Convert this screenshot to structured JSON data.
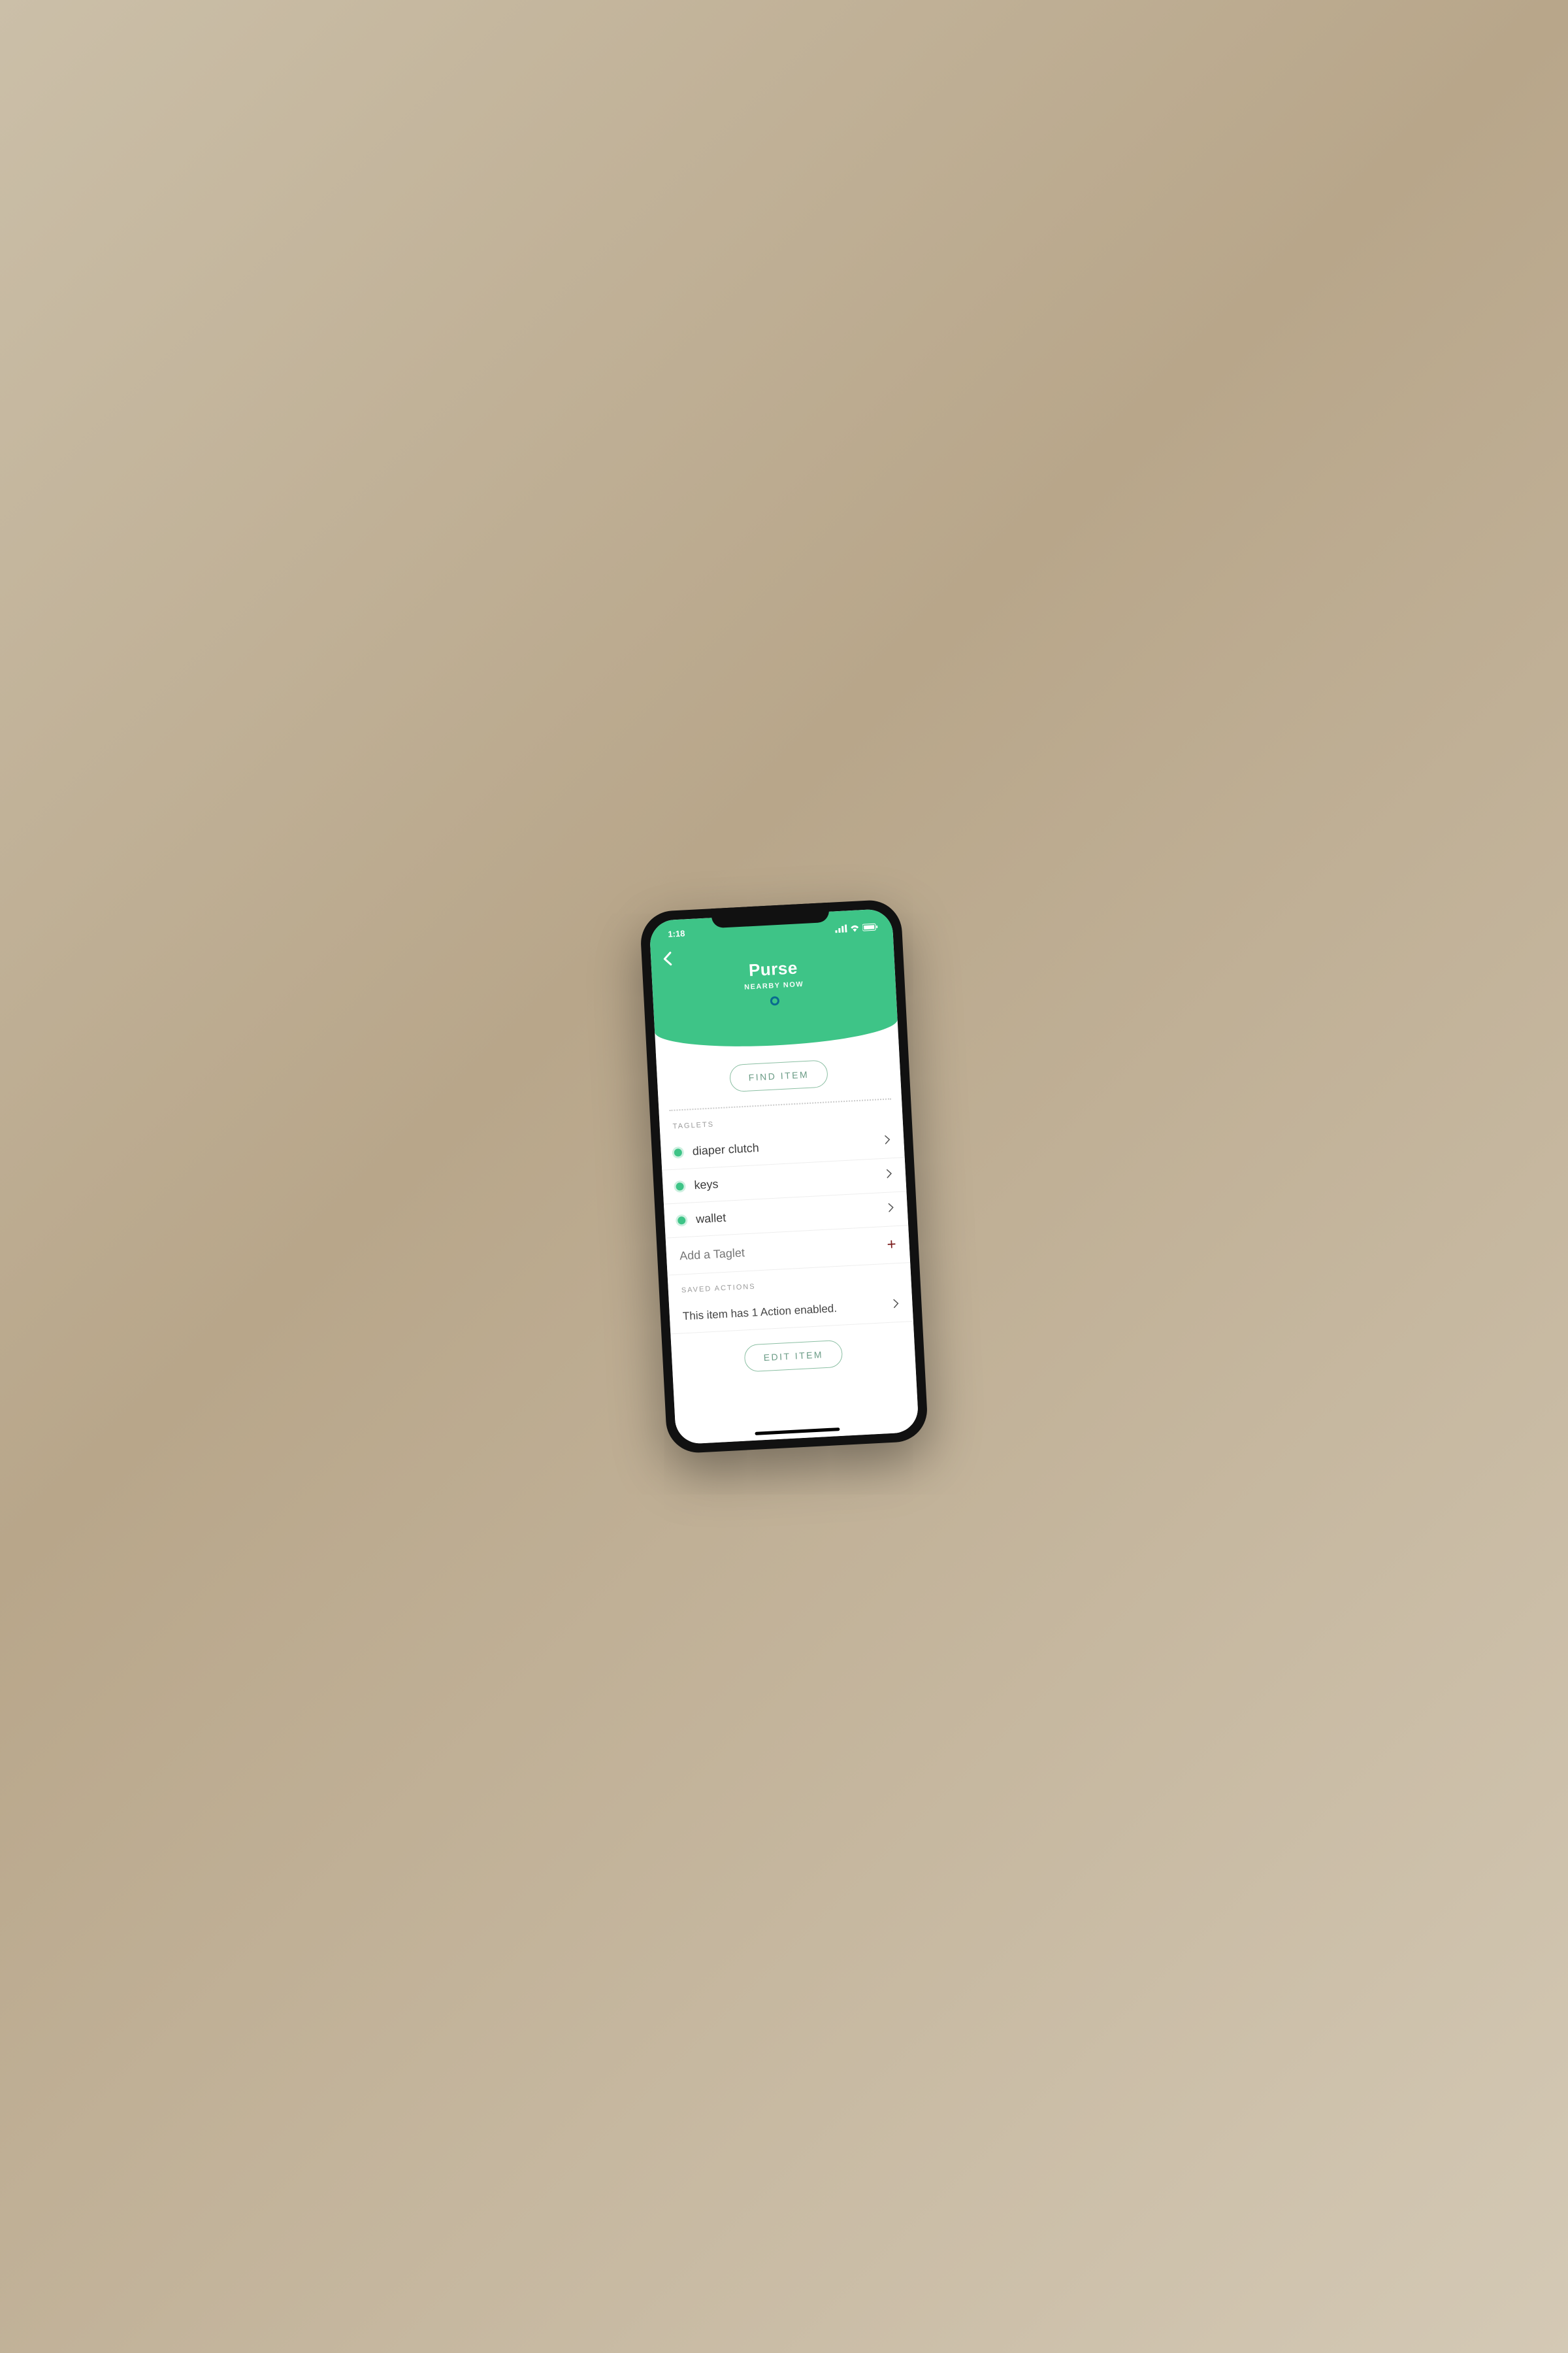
{
  "status_bar": {
    "time": "1:18",
    "signal": "●●●●",
    "wifi": "wifi",
    "battery": "battery"
  },
  "header": {
    "title": "Purse",
    "subtitle": "NEARBY NOW"
  },
  "buttons": {
    "find": "FIND ITEM",
    "edit": "EDIT ITEM"
  },
  "sections": {
    "taglets_label": "TAGLETS",
    "saved_actions_label": "SAVED ACTIONS"
  },
  "taglets": [
    {
      "name": "diaper clutch"
    },
    {
      "name": "keys"
    },
    {
      "name": "wallet"
    }
  ],
  "add_taglet_label": "Add a Taglet",
  "saved_actions_text": "This item has 1 Action enabled."
}
